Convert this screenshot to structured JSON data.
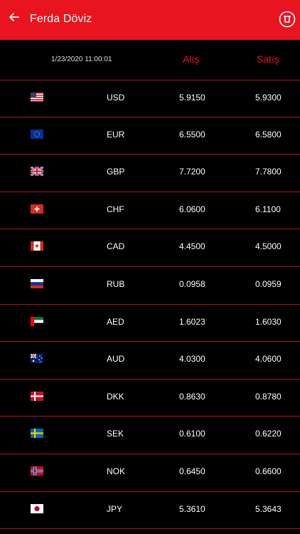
{
  "header": {
    "title": "Ferda Döviz",
    "back_icon": "arrow-left-icon",
    "logo_icon": "ferda-logo-icon",
    "brand_color": "#e8141f"
  },
  "table": {
    "timestamp": "1/23/2020 11:00:01",
    "buy_label": "Alış",
    "sell_label": "Satış",
    "rows": [
      {
        "flag": "us-flag-icon",
        "code": "USD",
        "buy": "5.9150",
        "sell": "5.9300"
      },
      {
        "flag": "eu-flag-icon",
        "code": "EUR",
        "buy": "6.5500",
        "sell": "6.5800"
      },
      {
        "flag": "gb-flag-icon",
        "code": "GBP",
        "buy": "7.7200",
        "sell": "7.7800"
      },
      {
        "flag": "ch-flag-icon",
        "code": "CHF",
        "buy": "6.0600",
        "sell": "6.1100"
      },
      {
        "flag": "ca-flag-icon",
        "code": "CAD",
        "buy": "4.4500",
        "sell": "4.5000"
      },
      {
        "flag": "ru-flag-icon",
        "code": "RUB",
        "buy": "0.0958",
        "sell": "0.0959"
      },
      {
        "flag": "ae-flag-icon",
        "code": "AED",
        "buy": "1.6023",
        "sell": "1.6030"
      },
      {
        "flag": "au-flag-icon",
        "code": "AUD",
        "buy": "4.0300",
        "sell": "4.0600"
      },
      {
        "flag": "dk-flag-icon",
        "code": "DKK",
        "buy": "0.8630",
        "sell": "0.8780"
      },
      {
        "flag": "se-flag-icon",
        "code": "SEK",
        "buy": "0.6100",
        "sell": "0.6220"
      },
      {
        "flag": "no-flag-icon",
        "code": "NOK",
        "buy": "0.6450",
        "sell": "0.6600"
      },
      {
        "flag": "jp-flag-icon",
        "code": "JPY",
        "buy": "5.3610",
        "sell": "5.3643"
      }
    ]
  }
}
